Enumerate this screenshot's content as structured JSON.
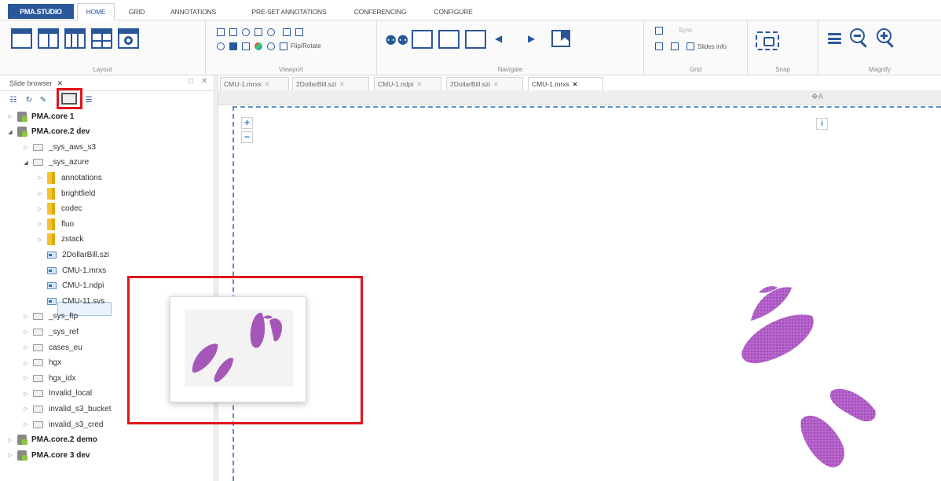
{
  "menubar": {
    "brand": "PMA.STUDIO",
    "tabs": [
      "HOME",
      "GRID",
      "ANNOTATIONS",
      "PRE-SET ANNOTATIONS",
      "CONFERENCING",
      "CONFIGURE"
    ],
    "active_tab": "HOME"
  },
  "ribbon": {
    "groups": {
      "layout": "Layout",
      "viewport": "Viewport",
      "navigate": "Navigate",
      "grid": "Grid",
      "snap": "Snap",
      "magnify": "Magnify"
    },
    "viewport_flip_rotate": "Flip/Rotate",
    "grid_sync": "Sync",
    "grid_slides_info": "Slides info"
  },
  "slide_browser": {
    "title": "Slide browser",
    "tree": [
      {
        "label": "PMA.core 1",
        "type": "server",
        "level": 0,
        "expanded": false
      },
      {
        "label": "PMA.core.2 dev",
        "type": "server",
        "level": 0,
        "expanded": true
      },
      {
        "label": "_sys_aws_s3",
        "type": "drive",
        "level": 1,
        "expanded": false
      },
      {
        "label": "_sys_azure",
        "type": "drive",
        "level": 1,
        "expanded": true
      },
      {
        "label": "annotations",
        "type": "folder",
        "level": 2,
        "expanded": false
      },
      {
        "label": "brightfield",
        "type": "folder",
        "level": 2,
        "expanded": false
      },
      {
        "label": "codec",
        "type": "folder",
        "level": 2,
        "expanded": false
      },
      {
        "label": "fluo",
        "type": "folder",
        "level": 2,
        "expanded": false
      },
      {
        "label": "zstack",
        "type": "folder",
        "level": 2,
        "expanded": false
      },
      {
        "label": "2DollarBill.szi",
        "type": "slide",
        "level": 2
      },
      {
        "label": "CMU-1.mrxs",
        "type": "slide",
        "level": 2
      },
      {
        "label": "CMU-1.ndpi",
        "type": "slide",
        "level": 2
      },
      {
        "label": "CMU-11.svs",
        "type": "slide",
        "level": 2,
        "selected": true
      },
      {
        "label": "_sys_ftp",
        "type": "drive",
        "level": 1,
        "expanded": false
      },
      {
        "label": "_sys_ref",
        "type": "drive",
        "level": 1,
        "expanded": false
      },
      {
        "label": "cases_eu",
        "type": "drive",
        "level": 1,
        "expanded": false
      },
      {
        "label": "hgx",
        "type": "drive",
        "level": 1,
        "expanded": false
      },
      {
        "label": "hgx_idx",
        "type": "drive",
        "level": 1,
        "expanded": false
      },
      {
        "label": "Invalid_local",
        "type": "drive",
        "level": 1,
        "expanded": false
      },
      {
        "label": "invalid_s3_bucket",
        "type": "drive",
        "level": 1,
        "expanded": false
      },
      {
        "label": "invalid_s3_cred",
        "type": "drive",
        "level": 1,
        "expanded": false
      },
      {
        "label": "PMA.core.2 demo",
        "type": "server",
        "level": 0,
        "expanded": false
      },
      {
        "label": "PMA.core 3 dev",
        "type": "server",
        "level": 0,
        "expanded": false
      }
    ]
  },
  "doc_tabs": [
    {
      "label": "CMU-1.mrxs",
      "active": false
    },
    {
      "label": "2DollarBill.szi",
      "active": false
    },
    {
      "label": "CMU-1.ndpi",
      "active": false
    },
    {
      "label": "2DollarBill.szi",
      "active": false
    },
    {
      "label": "CMU-1.mrxs",
      "active": true
    }
  ],
  "viewer": {
    "zoom_in": "+",
    "zoom_out": "−",
    "info": "i",
    "move_indicator": "✥A"
  },
  "colors": {
    "brand": "#2a579a",
    "highlight": "#e0151b",
    "tissue": "#b05cc4"
  }
}
